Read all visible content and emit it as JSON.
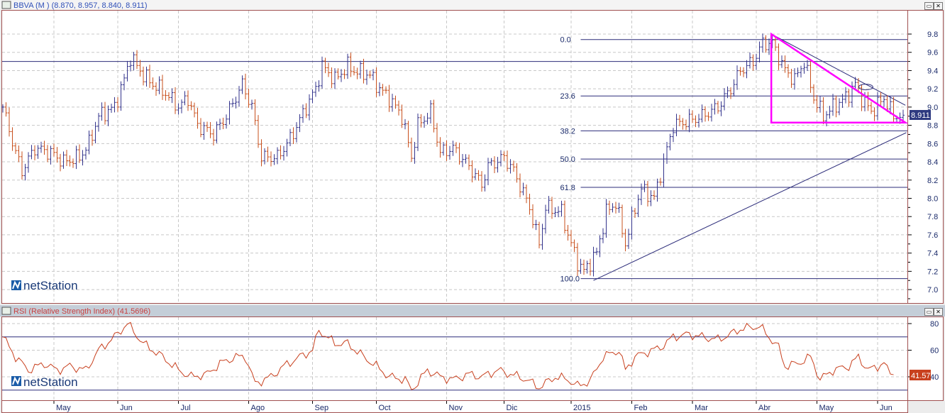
{
  "main_panel": {
    "title": "BBVA (M ) (8.870, 8.957, 8.840, 8.911)",
    "last_price_label": "8.911",
    "logo_text": "netStation"
  },
  "rsi_panel": {
    "title": "RSI (Relative Strength Index) (41.5696)",
    "last_value_label": "41.57",
    "logo_text": "netStation"
  },
  "colors": {
    "up": "#34348c",
    "down": "#c8501e",
    "rsi": "#c8401e",
    "fib": "#2c2c7a",
    "triangle": "#ff00ff",
    "frame": "#a05050",
    "last_price_bg": "#2e3a80",
    "last_rsi_bg": "#c8401e"
  },
  "chart_data": [
    {
      "type": "ohlc",
      "title": "BBVA (M )",
      "x_unit": "trading day index",
      "bar_count": 283,
      "ylim": [
        6.9,
        10.0
      ],
      "y_ticks": [
        "9.8",
        "9.6",
        "9.4",
        "9.2",
        "9.0",
        "8.8",
        "8.6",
        "8.4",
        "8.2",
        "8.0",
        "7.8",
        "7.6",
        "7.4",
        "7.2",
        "7.0"
      ],
      "close_anchors": [
        [
          0,
          9.0
        ],
        [
          4,
          8.5
        ],
        [
          6,
          8.3
        ],
        [
          10,
          8.55
        ],
        [
          15,
          8.5
        ],
        [
          19,
          8.4
        ],
        [
          24,
          8.45
        ],
        [
          27,
          8.6
        ],
        [
          30,
          8.9
        ],
        [
          35,
          9.0
        ],
        [
          38,
          9.3
        ],
        [
          40,
          9.55
        ],
        [
          44,
          9.35
        ],
        [
          47,
          9.25
        ],
        [
          51,
          9.15
        ],
        [
          55,
          9.0
        ],
        [
          58,
          9.1
        ],
        [
          61,
          8.8
        ],
        [
          66,
          8.7
        ],
        [
          70,
          8.9
        ],
        [
          75,
          9.25
        ],
        [
          78,
          9.0
        ],
        [
          81,
          8.45
        ],
        [
          86,
          8.45
        ],
        [
          90,
          8.65
        ],
        [
          95,
          9.0
        ],
        [
          98,
          9.2
        ],
        [
          100,
          9.45
        ],
        [
          104,
          9.3
        ],
        [
          108,
          9.45
        ],
        [
          110,
          9.4
        ],
        [
          115,
          9.35
        ],
        [
          118,
          9.2
        ],
        [
          121,
          9.1
        ],
        [
          125,
          8.9
        ],
        [
          128,
          8.45
        ],
        [
          130,
          8.8
        ],
        [
          134,
          8.95
        ],
        [
          137,
          8.5
        ],
        [
          141,
          8.55
        ],
        [
          146,
          8.35
        ],
        [
          150,
          8.15
        ],
        [
          152,
          8.35
        ],
        [
          157,
          8.45
        ],
        [
          160,
          8.3
        ],
        [
          165,
          7.9
        ],
        [
          168,
          7.5
        ],
        [
          170,
          7.9
        ],
        [
          175,
          7.85
        ],
        [
          177,
          7.6
        ],
        [
          180,
          7.3
        ],
        [
          182,
          7.2
        ],
        [
          186,
          7.4
        ],
        [
          189,
          7.85
        ],
        [
          192,
          7.95
        ],
        [
          195,
          7.5
        ],
        [
          198,
          7.9
        ],
        [
          200,
          8.1
        ],
        [
          204,
          8.0
        ],
        [
          207,
          8.4
        ],
        [
          210,
          8.8
        ],
        [
          215,
          8.85
        ],
        [
          219,
          8.9
        ],
        [
          224,
          9.0
        ],
        [
          228,
          9.2
        ],
        [
          231,
          9.4
        ],
        [
          235,
          9.5
        ],
        [
          238,
          9.7
        ],
        [
          241,
          9.7
        ],
        [
          245,
          9.4
        ],
        [
          248,
          9.3
        ],
        [
          251,
          9.5
        ],
        [
          254,
          9.1
        ],
        [
          257,
          8.9
        ],
        [
          260,
          9.0
        ],
        [
          264,
          9.1
        ],
        [
          267,
          9.25
        ],
        [
          269,
          9.1
        ],
        [
          272,
          8.95
        ],
        [
          276,
          9.1
        ],
        [
          279,
          8.9
        ],
        [
          282,
          8.911
        ]
      ],
      "horizontal_line": 9.5,
      "fibonacci": {
        "high": 9.74,
        "low": 7.12,
        "start_index": 181,
        "levels": [
          {
            "label": "0.0",
            "ratio": 0
          },
          {
            "label": "23.6",
            "ratio": 0.236
          },
          {
            "label": "38.2",
            "ratio": 0.382
          },
          {
            "label": "50.0",
            "ratio": 0.5
          },
          {
            "label": "61.8",
            "ratio": 0.618
          },
          {
            "label": "100.0",
            "ratio": 1
          }
        ]
      },
      "trendline": [
        [
          185,
          7.1
        ],
        [
          283,
          8.72
        ]
      ],
      "triangle": [
        [
          240.7,
          9.8
        ],
        [
          282.7,
          8.83
        ],
        [
          240.7,
          8.83
        ]
      ],
      "resistance_line": [
        [
          240.7,
          9.8
        ],
        [
          282.7,
          9.02
        ]
      ],
      "ellipse": [
        270.3,
        9.22
      ]
    },
    {
      "type": "line",
      "title": "RSI (Relative Strength Index)",
      "ylim": [
        20,
        85
      ],
      "y_ticks": [
        "80",
        "60",
        "40"
      ],
      "levels": [
        70,
        30
      ],
      "last_value": 41.5696,
      "anchors": [
        [
          0,
          70
        ],
        [
          4,
          55
        ],
        [
          8,
          45
        ],
        [
          13,
          50
        ],
        [
          17,
          45
        ],
        [
          21,
          48
        ],
        [
          26,
          45
        ],
        [
          30,
          60
        ],
        [
          35,
          70
        ],
        [
          39,
          80
        ],
        [
          44,
          65
        ],
        [
          47,
          60
        ],
        [
          50,
          55
        ],
        [
          55,
          45
        ],
        [
          59,
          40
        ],
        [
          64,
          42
        ],
        [
          68,
          50
        ],
        [
          73,
          55
        ],
        [
          76,
          55
        ],
        [
          79,
          35
        ],
        [
          84,
          40
        ],
        [
          88,
          48
        ],
        [
          93,
          55
        ],
        [
          97,
          60
        ],
        [
          99,
          75
        ],
        [
          104,
          65
        ],
        [
          108,
          65
        ],
        [
          113,
          55
        ],
        [
          117,
          48
        ],
        [
          121,
          40
        ],
        [
          126,
          38
        ],
        [
          128,
          30
        ],
        [
          133,
          45
        ],
        [
          137,
          40
        ],
        [
          141,
          38
        ],
        [
          146,
          42
        ],
        [
          150,
          40
        ],
        [
          155,
          45
        ],
        [
          159,
          42
        ],
        [
          164,
          38
        ],
        [
          168,
          32
        ],
        [
          173,
          40
        ],
        [
          177,
          38
        ],
        [
          180,
          33
        ],
        [
          184,
          37
        ],
        [
          188,
          55
        ],
        [
          193,
          60
        ],
        [
          195,
          45
        ],
        [
          198,
          55
        ],
        [
          201,
          58
        ],
        [
          206,
          62
        ],
        [
          210,
          70
        ],
        [
          215,
          72
        ],
        [
          219,
          70
        ],
        [
          224,
          68
        ],
        [
          228,
          72
        ],
        [
          231,
          76
        ],
        [
          237,
          78
        ],
        [
          240,
          70
        ],
        [
          243,
          62
        ],
        [
          245,
          48
        ],
        [
          249,
          50
        ],
        [
          253,
          55
        ],
        [
          256,
          38
        ],
        [
          260,
          45
        ],
        [
          265,
          48
        ],
        [
          268,
          55
        ],
        [
          271,
          45
        ],
        [
          276,
          50
        ],
        [
          278,
          42
        ],
        [
          279,
          41.57
        ]
      ]
    }
  ],
  "x_axis": {
    "months": [
      {
        "label": "May",
        "index": 16
      },
      {
        "label": "Jun",
        "index": 36
      },
      {
        "label": "Jul",
        "index": 55
      },
      {
        "label": "Ago",
        "index": 77
      },
      {
        "label": "Sep",
        "index": 97
      },
      {
        "label": "Oct",
        "index": 117
      },
      {
        "label": "Nov",
        "index": 139
      },
      {
        "label": "Dic",
        "index": 157
      },
      {
        "label": "2015",
        "index": 178
      },
      {
        "label": "Feb",
        "index": 197
      },
      {
        "label": "Mar",
        "index": 216
      },
      {
        "label": "Abr",
        "index": 236
      },
      {
        "label": "May",
        "index": 255
      },
      {
        "label": "Jun",
        "index": 274
      }
    ]
  }
}
